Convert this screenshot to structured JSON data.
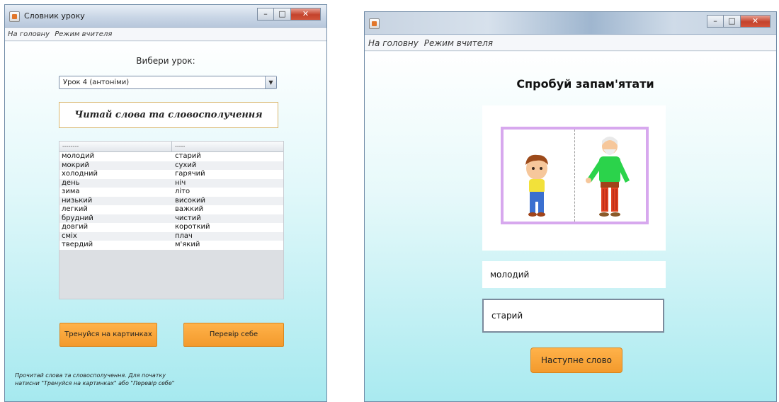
{
  "left_window": {
    "title": "Словник уроку",
    "menu": [
      "На головну",
      "Режим вчителя"
    ],
    "choose_label": "Вибери урок:",
    "lesson_select": {
      "selected": "Урок 4 (антоніми)"
    },
    "heading": "Читай слова та словосполучення",
    "table": {
      "headers": [
        "--------",
        "-----"
      ],
      "rows": [
        [
          "молодий",
          "старий"
        ],
        [
          "мокрий",
          "сухий"
        ],
        [
          "холодний",
          "гарячий"
        ],
        [
          "день",
          "ніч"
        ],
        [
          "зима",
          "літо"
        ],
        [
          "низький",
          "високий"
        ],
        [
          "легкий",
          "важкий"
        ],
        [
          "брудний",
          "чистий"
        ],
        [
          "довгий",
          "короткий"
        ],
        [
          "сміх",
          "плач"
        ],
        [
          "твердий",
          "м'який"
        ]
      ]
    },
    "btn_train": "Тренуйся на картинках",
    "btn_check": "Перевір себе",
    "hint_line1": "Прочитай слова та словосполучення. Для початку",
    "hint_line2": "натисни \"Тренуйся на картинках\" або \"Перевір себе\""
  },
  "right_window": {
    "title": "",
    "menu": [
      "На головну",
      "Режим вчителя"
    ],
    "heading": "Спробуй запам'ятати",
    "word1": "молодий",
    "word2": "старий",
    "btn_next": "Наступне слово"
  },
  "colors": {
    "accent_button": "#f7a23a",
    "heading_border": "#d9b66e",
    "picture_border": "#d7a8ee"
  },
  "icons": [
    "java-app-icon",
    "minimize-icon",
    "maximize-icon",
    "close-icon",
    "dropdown-arrow-icon"
  ]
}
